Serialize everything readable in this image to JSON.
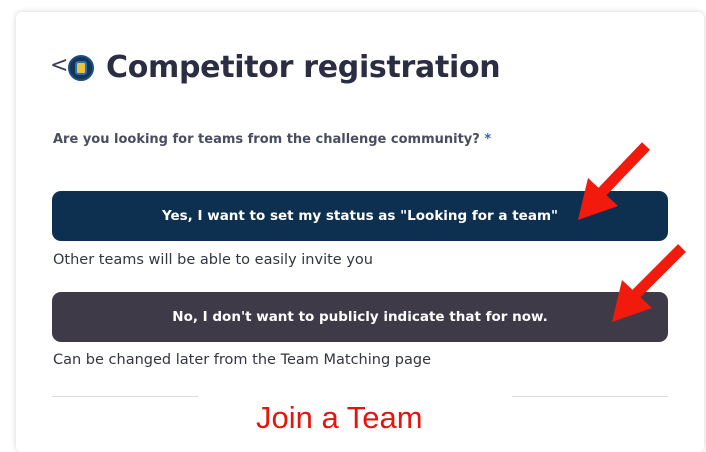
{
  "header": {
    "back_glyph": "<",
    "logo_icon": "shield-badge-icon",
    "title": "Competitor registration"
  },
  "form": {
    "question": "Are you looking for teams from the challenge community?",
    "required_marker": "*",
    "options": [
      {
        "label": "Yes, I want to set my status as \"Looking for a team\"",
        "hint": "Other teams will be able to easily invite you",
        "color": "#0e3050"
      },
      {
        "label": "No, I don't want to publicly indicate that for now.",
        "hint": "Can be changed later from the Team Matching page",
        "color": "#3e3a47"
      }
    ]
  },
  "annotation": {
    "join_label": "Join a Team",
    "arrow_color": "#f21a0d"
  }
}
